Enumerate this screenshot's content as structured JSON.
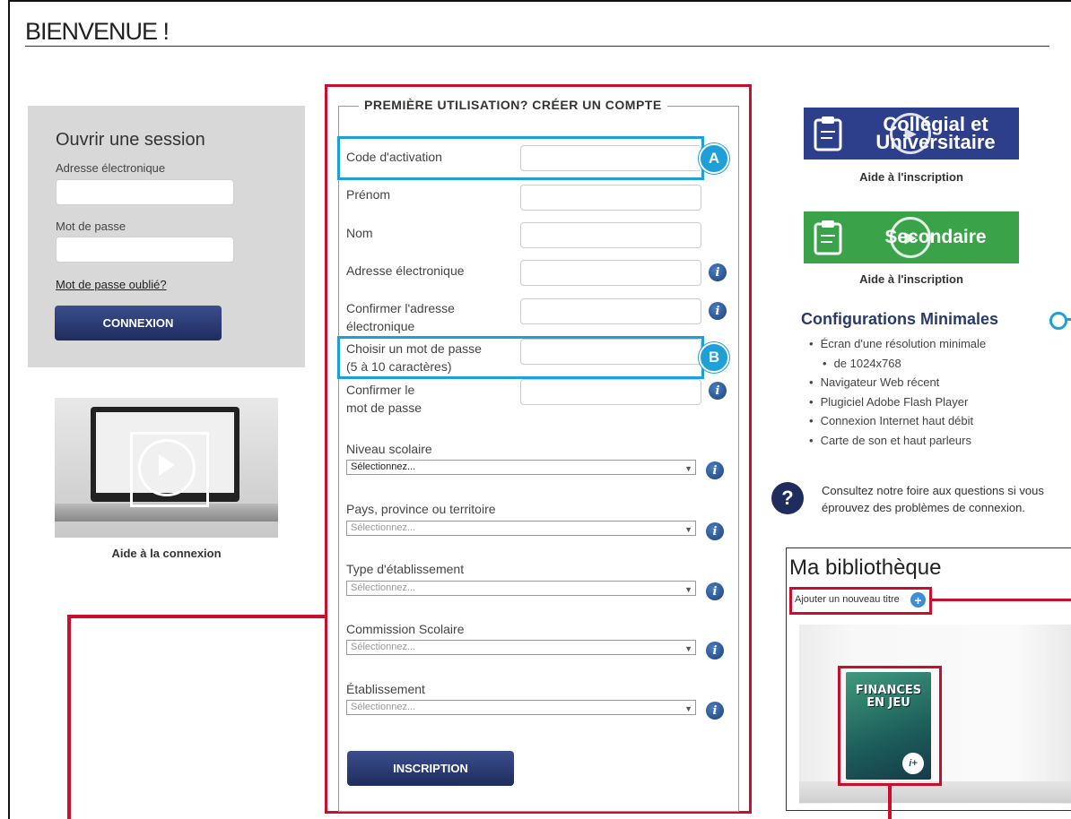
{
  "page": {
    "title": "BIENVENUE !"
  },
  "login": {
    "heading": "Ouvrir une session",
    "email_label": "Adresse électronique",
    "password_label": "Mot de passe",
    "forgot_link": "Mot de passe oublié?",
    "connect_button": "CONNEXION"
  },
  "video_help": {
    "caption": "Aide à la connexion"
  },
  "registration": {
    "legend": "PREMIÈRE UTILISATION? CRÉER UN COMPTE",
    "fields": {
      "activation_code": "Code d'activation",
      "first_name": "Prénom",
      "last_name": "Nom",
      "email": "Adresse électronique",
      "confirm_email_1": "Confirmer l'adresse",
      "confirm_email_2": "électronique",
      "choose_password_1": "Choisir un mot de passe",
      "choose_password_2": "(5 à 10 caractères)",
      "confirm_password_1": "Confirmer le",
      "confirm_password_2": "mot de passe"
    },
    "selects": {
      "school_level": {
        "label": "Niveau scolaire",
        "value": "Sélectionnez..."
      },
      "country": {
        "label": "Pays, province ou territoire",
        "value": "Sélectionnez..."
      },
      "institution_type": {
        "label": "Type d'établissement",
        "value": "Sélectionnez..."
      },
      "school_board": {
        "label": "Commission Scolaire",
        "value": "Sélectionnez..."
      },
      "institution": {
        "label": "Établissement",
        "value": "Sélectionnez..."
      }
    },
    "submit_button": "INSCRIPTION",
    "info_glyph": "i",
    "select_arrow": "▼"
  },
  "annotations": {
    "badge_a": "A",
    "badge_b": "B"
  },
  "right_column": {
    "college_banner_line1": "Collégial et",
    "college_banner_line2": "Universitaire",
    "college_help": "Aide à l'inscription",
    "secondary_banner": "Secondaire",
    "secondary_help": "Aide à l'inscription",
    "config_title": "Configurations Minimales",
    "config_items": [
      "Écran d'une résolution minimale",
      "de 1024x768",
      "Navigateur Web récent",
      "Plugiciel Adobe Flash Player",
      "Connexion Internet haut débit",
      "Carte de son et haut parleurs"
    ],
    "faq_text": "Consultez notre foire aux questions si vous éprouvez des problèmes de connexion.",
    "faq_icon": "?"
  },
  "library": {
    "title": "Ma bibliothèque",
    "add_title": "Ajouter un nouveau titre",
    "add_icon": "+",
    "book_title_1": "FINANCES",
    "book_title_2": "EN JEU",
    "book_badge": "i+"
  },
  "colors": {
    "annotation_red": "#c8102e",
    "annotation_blue": "#1e9fd8",
    "navy": "#1e2c5e",
    "college_blue": "#2d3f8a",
    "secondary_green": "#3aa34a"
  }
}
